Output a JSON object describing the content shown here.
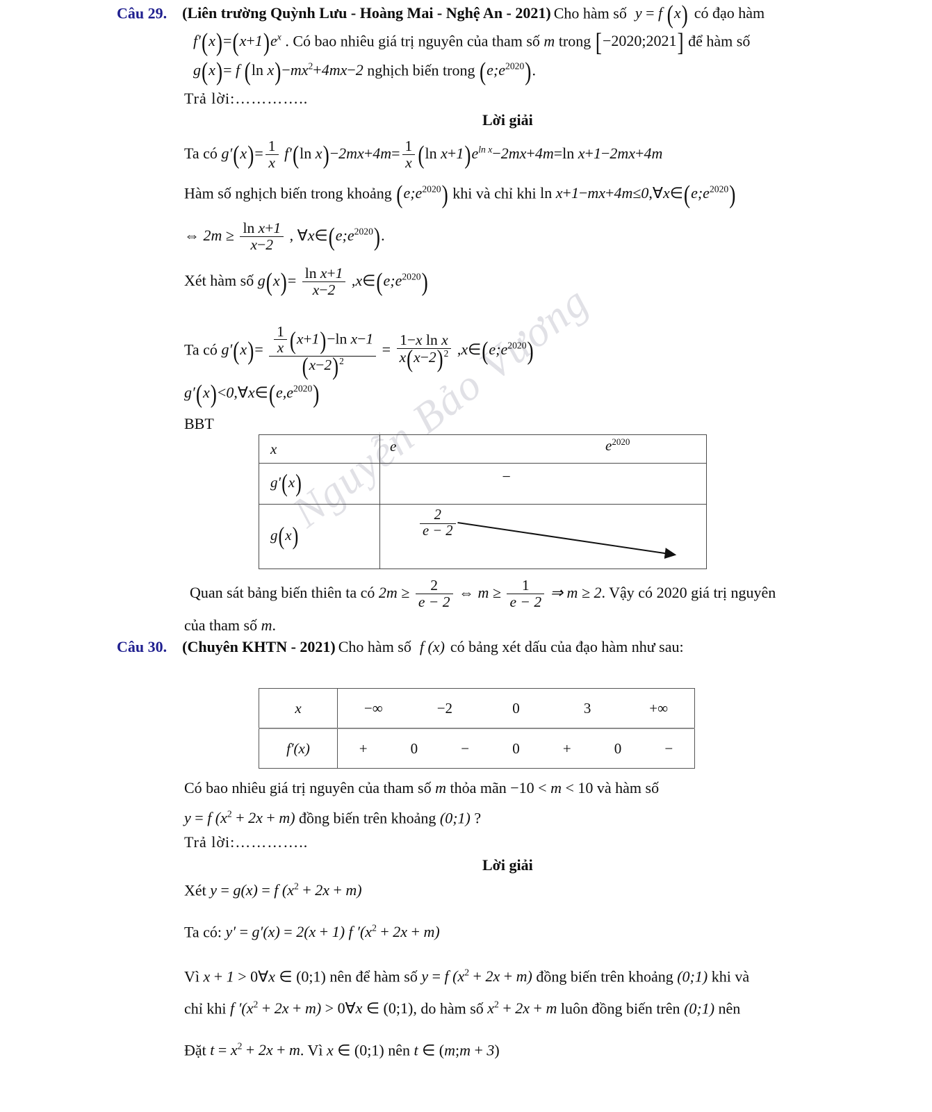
{
  "document": {
    "watermark": "Nguyễn Bảo Vương"
  },
  "q29": {
    "number": "Câu 29.",
    "source": "(Liên trường Quỳnh Lưu - Hoàng Mai - Nghệ An - 2021)",
    "stem_1": "Cho hàm số",
    "stem_1b": "có đạo hàm",
    "func": "y = f(x)",
    "deriv": "f′(x) = (x+1)eˣ",
    "stem_2": ". Có bao nhiêu giá trị nguyên của tham số",
    "param": "m",
    "stem_3": "trong",
    "interval": "[−2020; 2021]",
    "stem_4": "để hàm số",
    "g_def": "g(x) = f(ln x) − mx² + 4mx − 2",
    "stem_5": "nghịch biến trong",
    "domain": "(e; e^2020)",
    "answer_label": "Trả lời:…………..",
    "solution_heading": "Lời giải",
    "s1_prefix": "Ta có",
    "s1": "g′(x) = (1/x)·f′(ln x) − 2mx + 4m = (1/x)(ln x + 1)e^{ln x} − 2mx + 4m = ln x + 1 − 2mx + 4m",
    "s2_a": "Hàm số nghịch biến trong khoảng",
    "s2_b": "khi và chỉ khi",
    "s2_c": "ln x + 1 − mx + 4m ≤ 0, ∀x ∈",
    "s3": "⇔ 2m ≥ (ln x + 1)/(x − 2), ∀x ∈ (e; e^2020).",
    "s4_prefix": "Xét hàm số",
    "s4": "g(x) = (ln x + 1)/(x − 2), x ∈ (e; e^2020)",
    "s5_prefix": "Ta có",
    "s5": "g′(x) = [ (1/x)(x+1) − ln x − 1 ] / (x − 2)² = (1 − x ln x)/( x(x − 2)² ), x ∈ (e; e^2020)",
    "s6": "g′(x) < 0, ∀x ∈ (e, e^2020)",
    "bbt_label": "BBT",
    "bbt": {
      "row_labels": [
        "x",
        "g′(x)",
        "g(x)"
      ],
      "x_left": "e",
      "x_right": "e",
      "x_right_sup": "2020",
      "sign": "−",
      "value_num": "2",
      "value_den": "e − 2",
      "arrow": "decreasing"
    },
    "conclusion_a": "Quan sát bảng biến thiên ta có",
    "conclusion_math_1": "2m ≥",
    "conclusion_frac1_num": "2",
    "conclusion_frac1_den": "e − 2",
    "conclusion_math_2": "⇔ m ≥",
    "conclusion_frac2_num": "1",
    "conclusion_frac2_den": "e − 2",
    "conclusion_math_3": "⇒ m ≥ 2",
    "conclusion_b": ". Vậy có",
    "conclusion_count": "2020",
    "conclusion_c": "giá trị nguyên",
    "conclusion_d": "của tham số",
    "conclusion_param": "m",
    "conclusion_end": "."
  },
  "q30": {
    "number": "Câu 30.",
    "source": "(Chuyên KHTN - 2021)",
    "stem": "Cho hàm số",
    "func": "f(x)",
    "stem_b": "có bảng xét dấu của đạo hàm như sau:",
    "sign_table": {
      "row_labels": [
        "x",
        "f′(x)"
      ],
      "x_values": [
        "−∞",
        "−2",
        "0",
        "3",
        "+∞"
      ],
      "signs": [
        "+",
        "0",
        "−",
        "0",
        "+",
        "0",
        "−"
      ]
    },
    "q_a": "Có bao nhiêu giá trị nguyên của tham số",
    "q_param": "m",
    "q_b": "thỏa mãn",
    "q_cond": "−10 < m < 10",
    "q_c": "và hàm số",
    "q_func": "y = f(x² + 2x + m)",
    "q_d": "đồng biến trên khoảng",
    "q_interval": "(0;1)",
    "q_e": "?",
    "answer_label": "Trả lời:…………..",
    "solution_heading": "Lời giải",
    "l1_prefix": "Xét",
    "l1": "y = g(x) = f(x² + 2x + m)",
    "l2_prefix": "Ta có:",
    "l2": "y′ = g′(x) = 2(x + 1) f′(x² + 2x + m)",
    "l3_a": "Vì",
    "l3_math1": "x + 1 > 0 ∀x ∈ (0;1)",
    "l3_b": "nên để hàm số",
    "l3_math2": "y = f(x² + 2x + m)",
    "l3_c": "đồng biến trên khoảng",
    "l3_math3": "(0;1)",
    "l3_d": "khi và",
    "l4_a": "chỉ khi",
    "l4_math1": "f′(x² + 2x + m) > 0 ∀x ∈ (0;1)",
    "l4_b": ", do hàm số",
    "l4_math2": "x² + 2x + m",
    "l4_c": "luôn đồng biến trên",
    "l4_math3": "(0;1)",
    "l4_d": "nên",
    "l5_a": "Đặt",
    "l5_math1": "t = x² + 2x + m",
    "l5_b": ". Vì",
    "l5_math2": "x ∈ (0;1)",
    "l5_c": "nên",
    "l5_math3": "t ∈ (m; m + 3)"
  }
}
